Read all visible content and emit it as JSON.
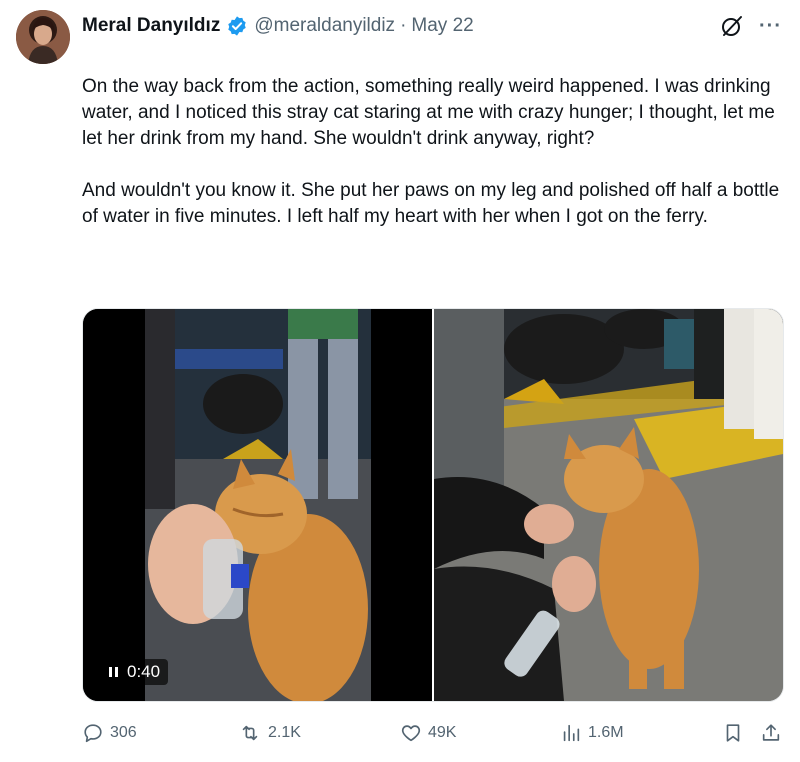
{
  "author": {
    "display_name": "Meral Danyıldız",
    "handle": "@meraldanyildiz",
    "separator": "·",
    "date": "May 22",
    "avatar_icon": "avatar-woman-icon",
    "verified_icon": "verified-badge-icon"
  },
  "header_actions": {
    "grok_icon": "grok-slash-icon",
    "more_label": "···"
  },
  "tweet": {
    "paragraphs": [
      "On the way back from the action, something really weird happened. I was drinking water, and I noticed this stray cat staring at me with crazy hunger; I thought, let me let her drink from my hand. She wouldn't drink anyway, right?",
      "And wouldn't you know it. She put her paws on my leg and polished off half a bottle of water in five minutes. I left half my heart with her when I got on the ferry."
    ]
  },
  "media": {
    "video_time": "0:40",
    "pause_icon": "pause-icon",
    "left_description_icon": "video-cat-drinking",
    "right_description_icon": "photo-cat-standing"
  },
  "actions": {
    "replies": "306",
    "reposts": "2.1K",
    "likes": "49K",
    "views": "1.6M"
  },
  "colors": {
    "text": "#0f1419",
    "secondary": "#536471",
    "verified": "#1d9bf0"
  }
}
